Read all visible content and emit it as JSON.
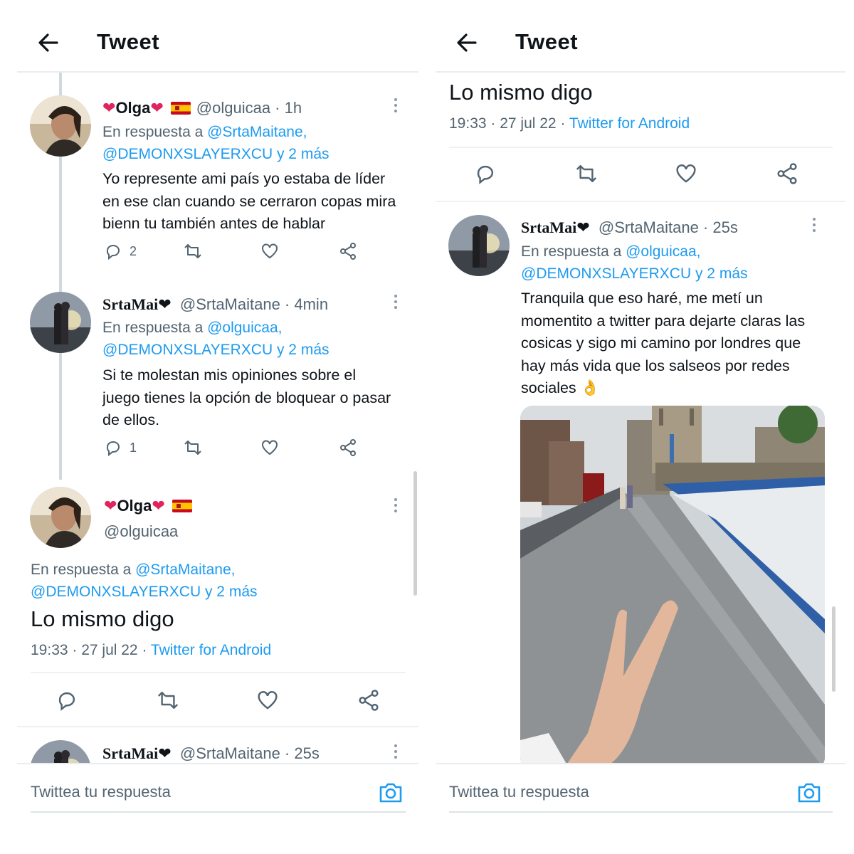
{
  "header": {
    "title": "Tweet"
  },
  "composer": {
    "placeholder": "Twittea tu respuesta"
  },
  "users": {
    "olga": {
      "name": "Olga",
      "handle": "@olguicaa"
    },
    "srta": {
      "name": "SrtaMai",
      "handle": "@SrtaMaitane"
    }
  },
  "left": {
    "t1": {
      "handle_time": "@olguicaa · 1h",
      "reply_prefix": "En respuesta a ",
      "reply_line1": "@SrtaMaitane,",
      "reply_line2": "@DEMONXSLAYERXCU y 2 más",
      "text": "Yo represente ami país yo estaba de líder en ese clan cuando se cerraron copas mira bienn tu también antes de hablar",
      "reply_count": "2"
    },
    "t2": {
      "handle_time": "@SrtaMaitane · 4min",
      "reply_prefix": "En respuesta a ",
      "reply_line1": "@olguicaa,",
      "reply_line2": "@DEMONXSLAYERXCU y 2 más",
      "text": "Si te molestan mis opiniones sobre el juego tienes la opción de bloquear o pasar de ellos.",
      "reply_count": "1"
    },
    "focus": {
      "handle": "@olguicaa",
      "reply_prefix": "En respuesta a ",
      "reply_line1": "@SrtaMaitane,",
      "reply_line2": "@DEMONXSLAYERXCU y 2 más",
      "text": "Lo mismo digo",
      "time": "19:33 · 27 jul 22 · ",
      "source": "Twitter for Android"
    },
    "t3": {
      "handle_time": "@SrtaMaitane · 25s"
    }
  },
  "right": {
    "focus": {
      "text": "Lo mismo digo",
      "time": "19:33 · 27 jul 22 · ",
      "source": "Twitter for Android"
    },
    "t1": {
      "handle_time": "@SrtaMaitane · 25s",
      "reply_prefix": "En respuesta a ",
      "reply_line1": "@olguicaa,",
      "reply_line2": "@DEMONXSLAYERXCU y 2 más",
      "text": "Tranquila que eso haré, me metí un momentito a twitter para dejarte claras las cosicas y sigo mi camino por londres que hay más vida que los salseos por redes sociales 👌"
    }
  },
  "icons": [
    "back-arrow-icon",
    "kebab-icon",
    "reply-icon",
    "retweet-icon",
    "like-icon",
    "share-icon",
    "camera-icon"
  ],
  "colors": {
    "link": "#1d9bf0",
    "muted": "#536471",
    "heart": "#e0245e"
  }
}
